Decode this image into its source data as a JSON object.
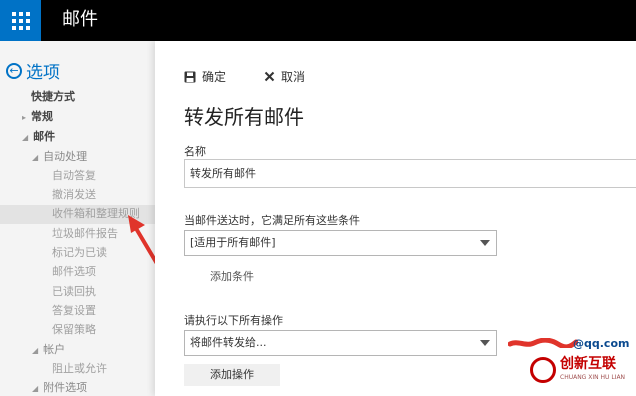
{
  "header": {
    "app_title": "邮件",
    "launcher_icon": "app-launcher-grid-icon"
  },
  "nav": {
    "back_label": "选项",
    "items": [
      {
        "label": "快捷方式"
      },
      {
        "label": "常规"
      },
      {
        "label": "邮件"
      },
      {
        "label": "自动处理"
      },
      {
        "label": "自动答复"
      },
      {
        "label": "撤消发送"
      },
      {
        "label": "收件箱和整理规则"
      },
      {
        "label": "垃圾邮件报告"
      },
      {
        "label": "标记为已读"
      },
      {
        "label": "邮件选项"
      },
      {
        "label": "已读回执"
      },
      {
        "label": "答复设置"
      },
      {
        "label": "保留策略"
      },
      {
        "label": "帐户"
      },
      {
        "label": "阻止或允许"
      },
      {
        "label": "附件选项"
      }
    ],
    "selected_index": 6
  },
  "toolbar": {
    "save_label": "确定",
    "save_icon": "save-icon",
    "cancel_label": "取消",
    "cancel_icon": "close-icon"
  },
  "form": {
    "title": "转发所有邮件",
    "name_label": "名称",
    "name_value": "转发所有邮件",
    "condition_label": "当邮件送达时，它满足所有这些条件",
    "condition_value": "[适用于所有邮件]",
    "add_condition": "添加条件",
    "action_label": "请执行以下所有操作",
    "action_value": "将邮件转发给...",
    "action_target_suffix": "@qq.com",
    "add_action": "添加操作"
  },
  "watermark": {
    "name": "创新互联",
    "sub": "CHUANG XIN HU LIAN"
  },
  "colors": {
    "accent": "#0072c6",
    "topbar": "#000000",
    "annotation": "#e0342b"
  }
}
